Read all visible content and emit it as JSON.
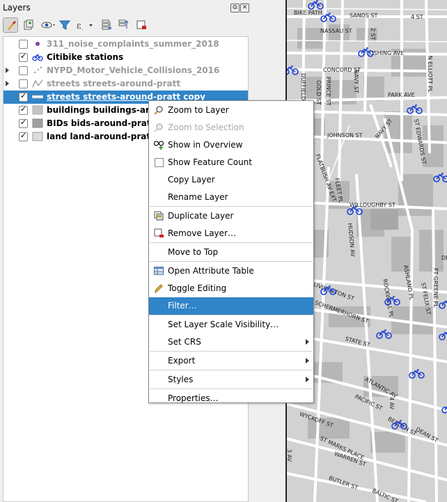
{
  "panel": {
    "title": "Layers",
    "float_btn": "⧉",
    "close_btn": "✕"
  },
  "toolbar": {
    "tools": [
      "style-manager",
      "add-group",
      "visibility",
      "filter-legend",
      "expression-filter",
      "expand-all",
      "collapse-all",
      "remove-layer"
    ]
  },
  "layers": [
    {
      "name": "311_noise_complaints_summer_2018",
      "checked": false,
      "expandable": false,
      "style": "grey",
      "symbol": "purple-dot"
    },
    {
      "name": "Citibike stations",
      "checked": true,
      "expandable": false,
      "style": "bold",
      "symbol": "bike"
    },
    {
      "name": "NYPD_Motor_Vehicle_Collisions_2016",
      "checked": false,
      "expandable": true,
      "style": "grey",
      "symbol": "dots"
    },
    {
      "name": "streets streets-around-pratt",
      "checked": false,
      "expandable": true,
      "style": "grey",
      "symbol": "line"
    },
    {
      "name": "streets streets-around-pratt copy",
      "checked": true,
      "expandable": false,
      "style": "selected",
      "symbol": "white-line"
    },
    {
      "name": "buildings buildings-around-pratt",
      "checked": true,
      "expandable": false,
      "style": "bold",
      "symbol": "light-grey-fill"
    },
    {
      "name": "BIDs bids-around-pratt",
      "checked": true,
      "expandable": false,
      "style": "bold",
      "symbol": "grey-fill"
    },
    {
      "name": "land land-around-pratt",
      "checked": true,
      "expandable": false,
      "style": "bold",
      "symbol": "pale-fill"
    }
  ],
  "context_menu": {
    "items": [
      {
        "label": "Zoom to Layer",
        "icon": "zoom-layer-icon",
        "state": "normal"
      },
      {
        "label": "Zoom to Selection",
        "icon": "zoom-selection-icon",
        "state": "disabled"
      },
      {
        "label": "Show in Overview",
        "icon": "overview-icon",
        "state": "normal"
      },
      {
        "label": "Show Feature Count",
        "icon": "checkbox",
        "state": "normal"
      },
      {
        "label": "Copy Layer",
        "icon": "",
        "state": "normal"
      },
      {
        "label": "Rename Layer",
        "icon": "",
        "state": "normal"
      },
      {
        "label": "Duplicate Layer",
        "icon": "duplicate-icon",
        "state": "normal"
      },
      {
        "label": "Remove Layer…",
        "icon": "remove-icon",
        "state": "normal"
      },
      {
        "label": "Move to Top",
        "icon": "",
        "state": "normal"
      },
      {
        "label": "Open Attribute Table",
        "icon": "table-icon",
        "state": "normal"
      },
      {
        "label": "Toggle Editing",
        "icon": "pencil-icon",
        "state": "normal"
      },
      {
        "label": "Filter…",
        "icon": "",
        "state": "highlighted"
      },
      {
        "label": "Set Layer Scale Visibility…",
        "icon": "",
        "state": "normal"
      },
      {
        "label": "Set CRS",
        "icon": "",
        "state": "submenu"
      },
      {
        "label": "Export",
        "icon": "",
        "state": "submenu"
      },
      {
        "label": "Styles",
        "icon": "",
        "state": "submenu"
      },
      {
        "label": "Properties…",
        "icon": "",
        "state": "normal"
      }
    ]
  },
  "map": {
    "street_labels": [
      "BIKE PATH",
      "SANDS ST",
      "NASSAU ST",
      "FLUSHING AVE",
      "CONCORD ST",
      "PARK AVE",
      "JOHNSON ST",
      "WILLOUGHBY ST",
      "DUFFIELD ST",
      "GOLD ST",
      "PRINCE ST",
      "NAVY ST",
      "ST EDWARDS ST",
      "N ELLIOTT PL",
      "FLATBUSH AV EXT",
      "FLEET PL",
      "HUDSON AV",
      "NAVY ST",
      "ASHLAND PL",
      "ST FELIX ST",
      "FT GREENE PL",
      "LIVINGSTON ST",
      "SCHERMERHORN ST",
      "STATE ST",
      "ATLANTIC AV",
      "PACIFIC ST",
      "DEAN ST",
      "WYCKOFF ST",
      "ST MARKS PLACE",
      "BERGEN ST",
      "WARREN ST",
      "BUTLER ST",
      "BALTIC ST",
      "4 AV",
      "3 AV",
      "4 ST",
      "2 ST",
      "ROCKWELL PL",
      "DE"
    ],
    "colors": {
      "street": "#ffffff",
      "building": "#b8b8b8",
      "land": "#d0d0d0",
      "bike": "#1c3fd6"
    }
  }
}
